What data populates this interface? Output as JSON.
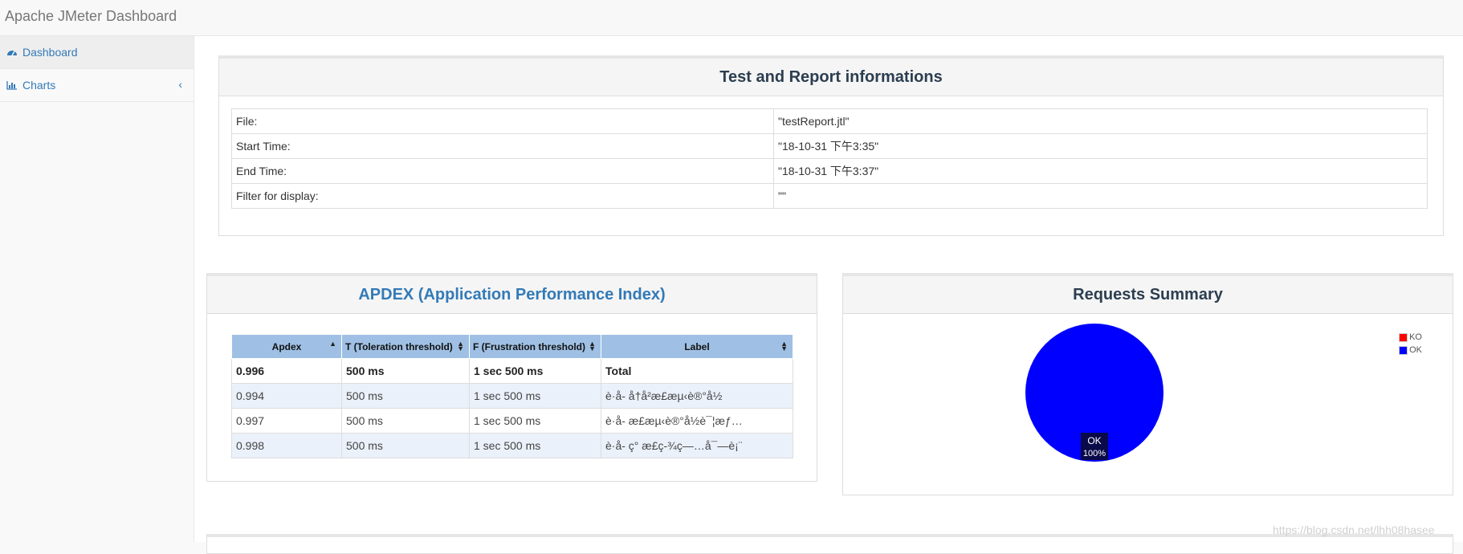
{
  "app": {
    "title": "Apache JMeter Dashboard"
  },
  "sidebar": {
    "items": [
      {
        "label": "Dashboard",
        "icon": "dashboard-icon",
        "active": true
      },
      {
        "label": "Charts",
        "icon": "bar-chart-icon",
        "active": false
      }
    ]
  },
  "test_info": {
    "title": "Test and Report informations",
    "rows": [
      {
        "key": "File:",
        "value": "\"testReport.jtl\""
      },
      {
        "key": "Start Time:",
        "value": "\"18-10-31 下午3:35\""
      },
      {
        "key": "End Time:",
        "value": "\"18-10-31 下午3:37\""
      },
      {
        "key": "Filter for display:",
        "value": "\"\""
      }
    ]
  },
  "apdex": {
    "title": "APDEX (Application Performance Index)",
    "headers": [
      "Apdex",
      "T (Toleration threshold)",
      "F (Frustration threshold)",
      "Label"
    ],
    "rows": [
      {
        "apdex": "0.996",
        "t": "500 ms",
        "f": "1 sec 500 ms",
        "label": "Total"
      },
      {
        "apdex": "0.994",
        "t": "500 ms",
        "f": "1 sec 500 ms",
        "label": "è·å- å†å²æ£æµ‹è®°å½"
      },
      {
        "apdex": "0.997",
        "t": "500 ms",
        "f": "1 sec 500 ms",
        "label": "è·å- æ£æµ‹è®°å½è¯¦æƒ…"
      },
      {
        "apdex": "0.998",
        "t": "500 ms",
        "f": "1 sec 500 ms",
        "label": "è·å- ç° æ£ç-¾ç—…å¯—è¡¨"
      }
    ]
  },
  "requests_summary": {
    "title": "Requests Summary",
    "legend": [
      {
        "name": "KO",
        "color": "#ff0000"
      },
      {
        "name": "OK",
        "color": "#0000ff"
      }
    ],
    "slice_label": "OK",
    "slice_pct": "100%"
  },
  "chart_data": {
    "type": "pie",
    "title": "Requests Summary",
    "categories": [
      "KO",
      "OK"
    ],
    "values": [
      0,
      100
    ],
    "colors": [
      "#ff0000",
      "#0000ff"
    ],
    "legend": "top-right"
  },
  "watermark": "https://blog.csdn.net/lhh08hasee"
}
